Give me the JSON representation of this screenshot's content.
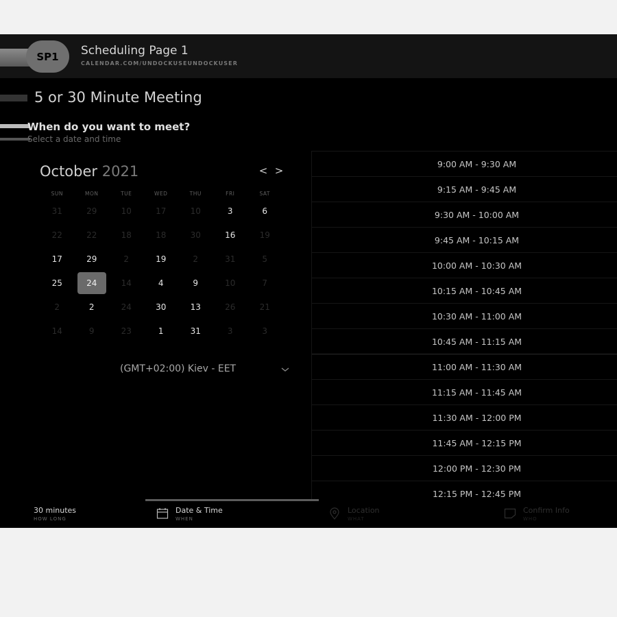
{
  "header": {
    "avatar": "SP1",
    "page_name": "Scheduling Page 1",
    "url": "CALENDAR.COM/UNDOCKUSEUNDOCKUSER"
  },
  "meeting": {
    "title": "5 or 30 Minute Meeting",
    "question": "When do you want to meet?",
    "subtext": "Select a date and time"
  },
  "calendar": {
    "month": "October",
    "year": "2021",
    "prev": "<",
    "next": ">",
    "weekdays": [
      "SUN",
      "MON",
      "TUE",
      "WED",
      "THU",
      "FRI",
      "SAT"
    ],
    "days": [
      {
        "d": "31",
        "avail": false
      },
      {
        "d": "29",
        "avail": false
      },
      {
        "d": "10",
        "avail": false
      },
      {
        "d": "17",
        "avail": false
      },
      {
        "d": "10",
        "avail": false
      },
      {
        "d": "3",
        "avail": true
      },
      {
        "d": "6",
        "avail": true
      },
      {
        "d": "22",
        "avail": false
      },
      {
        "d": "22",
        "avail": false
      },
      {
        "d": "18",
        "avail": false
      },
      {
        "d": "18",
        "avail": false
      },
      {
        "d": "30",
        "avail": false
      },
      {
        "d": "16",
        "avail": true
      },
      {
        "d": "19",
        "avail": false
      },
      {
        "d": "17",
        "avail": true
      },
      {
        "d": "29",
        "avail": true
      },
      {
        "d": "2",
        "avail": false
      },
      {
        "d": "19",
        "avail": true
      },
      {
        "d": "2",
        "avail": false
      },
      {
        "d": "31",
        "avail": false
      },
      {
        "d": "5",
        "avail": false
      },
      {
        "d": "25",
        "avail": true
      },
      {
        "d": "24",
        "avail": true,
        "selected": true
      },
      {
        "d": "14",
        "avail": false
      },
      {
        "d": "4",
        "avail": true
      },
      {
        "d": "9",
        "avail": true
      },
      {
        "d": "10",
        "avail": false
      },
      {
        "d": "7",
        "avail": false
      },
      {
        "d": "2",
        "avail": false
      },
      {
        "d": "2",
        "avail": true
      },
      {
        "d": "24",
        "avail": false
      },
      {
        "d": "30",
        "avail": true
      },
      {
        "d": "13",
        "avail": true
      },
      {
        "d": "26",
        "avail": false
      },
      {
        "d": "21",
        "avail": false
      },
      {
        "d": "14",
        "avail": false
      },
      {
        "d": "9",
        "avail": false
      },
      {
        "d": "23",
        "avail": false
      },
      {
        "d": "1",
        "avail": true
      },
      {
        "d": "31",
        "avail": true
      },
      {
        "d": "3",
        "avail": false
      },
      {
        "d": "3",
        "avail": false
      }
    ],
    "timezone": "(GMT+02:00) Kiev - EET"
  },
  "slots": [
    "9:00 AM - 9:30 AM",
    "9:15 AM - 9:45 AM",
    "9:30 AM - 10:00 AM",
    "9:45 AM - 10:15 AM",
    "10:00 AM - 10:30 AM",
    "10:15 AM - 10:45 AM",
    "10:30 AM - 11:00 AM",
    "10:45 AM - 11:15 AM",
    "11:00 AM - 11:30 AM",
    "11:15 AM - 11:45 AM",
    "11:30 AM - 12:00 PM",
    "11:45 AM - 12:15 PM",
    "12:00 PM - 12:30 PM",
    "12:15 PM - 12:45 PM"
  ],
  "steps": [
    {
      "label": "30 minutes",
      "sub": "HOW LONG",
      "icon": "none"
    },
    {
      "label": "Date & Time",
      "sub": "WHEN",
      "icon": "calendar-icon"
    },
    {
      "label": "Location",
      "sub": "WHAT",
      "icon": "location-pin-icon"
    },
    {
      "label": "Confirm Info",
      "sub": "WHO",
      "icon": "note-icon"
    }
  ]
}
